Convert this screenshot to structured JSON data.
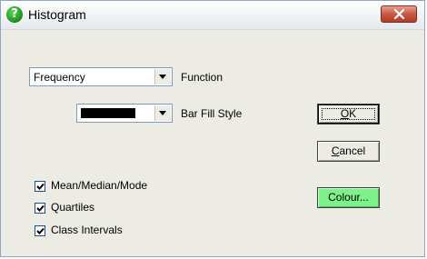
{
  "window": {
    "title": "Histogram"
  },
  "function_select": {
    "value": "Frequency",
    "label": "Function"
  },
  "bar_fill_select": {
    "value_color": "#000000",
    "label": "Bar Fill Style"
  },
  "buttons": {
    "ok_mnemonic": "O",
    "ok_rest": "K",
    "cancel_mnemonic": "C",
    "cancel_rest": "ancel",
    "colour_label": "Colour...",
    "colour_bg": "#7ef28a"
  },
  "checkboxes": [
    {
      "label": "Mean/Median/Mode",
      "checked": true
    },
    {
      "label": "Quartiles",
      "checked": true
    },
    {
      "label": "Class Intervals",
      "checked": true
    }
  ],
  "icons": {
    "title": "help-question-icon",
    "close": "close-x-icon",
    "dropdown": "dropdown-arrow-icon",
    "check": "checkmark-icon"
  }
}
